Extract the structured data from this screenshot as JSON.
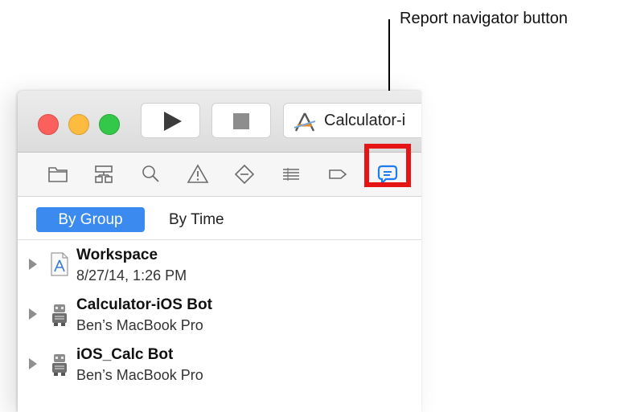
{
  "annotation": {
    "label": "Report navigator button"
  },
  "toolbar": {
    "scheme_label": "Calculator-i"
  },
  "navigator_icons": [
    {
      "icon": "folder-icon",
      "name": "project-navigator"
    },
    {
      "icon": "hierarchy-icon",
      "name": "symbol-navigator"
    },
    {
      "icon": "search-icon",
      "name": "find-navigator"
    },
    {
      "icon": "warning-icon",
      "name": "issue-navigator"
    },
    {
      "icon": "test-diamond-icon",
      "name": "test-navigator"
    },
    {
      "icon": "debug-list-icon",
      "name": "debug-navigator"
    },
    {
      "icon": "breakpoint-icon",
      "name": "breakpoint-navigator"
    },
    {
      "icon": "speech-bubble-icon",
      "name": "report-navigator",
      "active": true
    }
  ],
  "segments": {
    "by_group": "By Group",
    "by_time": "By Time"
  },
  "reports": [
    {
      "title": "Workspace",
      "subtitle": "8/27/14, 1:26 PM",
      "icon": "workspace-doc-icon"
    },
    {
      "title": "Calculator-iOS Bot",
      "subtitle": "Ben’s MacBook Pro",
      "icon": "bot-icon"
    },
    {
      "title": "iOS_Calc Bot",
      "subtitle": "Ben’s MacBook Pro",
      "icon": "bot-icon"
    }
  ],
  "colors": {
    "accent": "#3a8af0",
    "highlight": "#e61515"
  }
}
